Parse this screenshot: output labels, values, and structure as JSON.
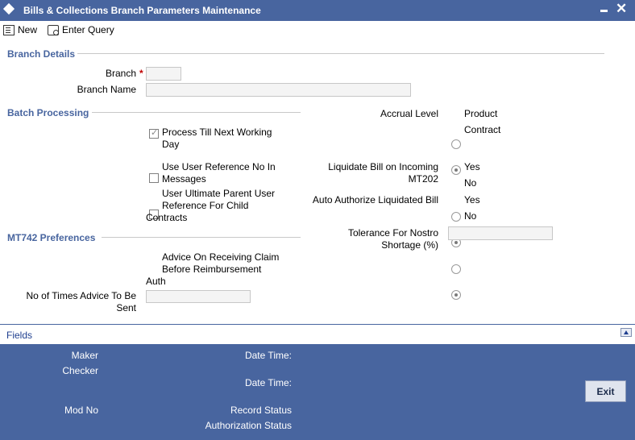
{
  "window": {
    "title": "Bills & Collections Branch Parameters Maintenance"
  },
  "toolbar": {
    "new_label": "New",
    "enter_query_label": "Enter Query"
  },
  "branch_details": {
    "section_title": "Branch Details",
    "branch_label": "Branch",
    "required_mark": "*",
    "branch_value": "",
    "branch_name_label": "Branch Name",
    "branch_name_value": ""
  },
  "batch_processing": {
    "section_title": "Batch Processing",
    "process_till_next_working_day": {
      "line1": "Process Till Next Working",
      "line2": "Day",
      "checked": true
    },
    "use_user_reference": {
      "line1": "Use User Reference No In",
      "line2": "Messages",
      "checked": false
    },
    "user_ultimate_parent": {
      "line1": "User Ultimate Parent User",
      "line2": "Reference For Child",
      "line3": "Contracts",
      "checked": false
    }
  },
  "accrual_level": {
    "label": "Accrual Level",
    "options": [
      {
        "label": "Product",
        "checked": false
      },
      {
        "label": "Contract",
        "checked": true
      }
    ]
  },
  "liquidate_bill": {
    "label_line1": "Liquidate Bill on Incoming",
    "label_line2": "MT202",
    "options": [
      {
        "label": "Yes",
        "checked": false
      },
      {
        "label": "No",
        "checked": true
      }
    ]
  },
  "auto_authorize": {
    "label": "Auto Authorize Liquidated Bill",
    "options": [
      {
        "label": "Yes",
        "checked": false
      },
      {
        "label": "No",
        "checked": true
      }
    ]
  },
  "tolerance": {
    "label_line1": "Tolerance For Nostro",
    "label_line2": "Shortage (%)",
    "value": ""
  },
  "mt742": {
    "section_title": "MT742 Preferences",
    "advice_on_receiving": {
      "line1": "Advice On Receiving Claim",
      "line2": "Before Reimbursement",
      "line3": "Auth",
      "checked": false
    },
    "no_of_times_label_line1": "No of Times Advice To Be",
    "no_of_times_label_line2": "Sent",
    "no_of_times_value": ""
  },
  "fields_bar": {
    "label": "Fields"
  },
  "footer": {
    "maker_label": "Maker",
    "checker_label": "Checker",
    "date_time_label_1": "Date Time:",
    "date_time_label_2": "Date Time:",
    "mod_no_label": "Mod No",
    "record_status_label": "Record Status",
    "authorization_status_label": "Authorization Status",
    "exit_label": "Exit"
  },
  "colors": {
    "brand_blue": "#48659f",
    "section_text": "#48659f",
    "required": "#c00000"
  }
}
